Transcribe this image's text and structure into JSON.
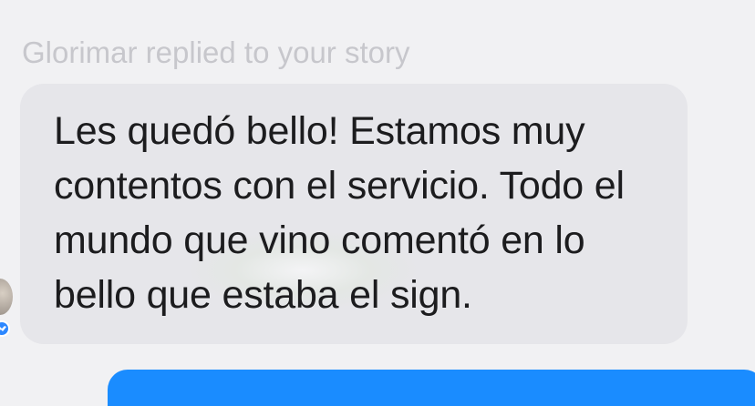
{
  "reply_context": {
    "text": "Glorimar replied to your story"
  },
  "message": {
    "text": "Les quedó bello! Estamos muy contentos con el servicio. Todo el mundo que vino comentó en lo bello que estaba el sign."
  },
  "icons": {
    "avatar": "contact-avatar",
    "badge": "messenger-badge-icon"
  },
  "colors": {
    "background": "#f1f1f3",
    "bubble": "#e6e6ea",
    "reply_text": "#c7c7cc",
    "message_text": "#1c1c1e",
    "sent_bubble": "#1a8cff"
  }
}
